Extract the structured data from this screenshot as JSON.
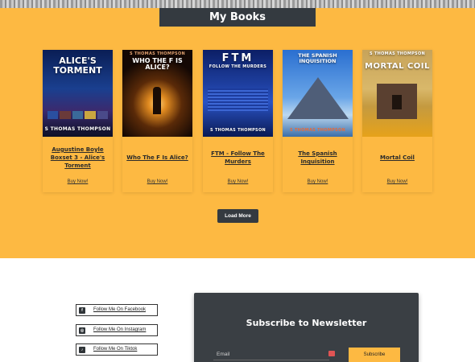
{
  "books_section": {
    "heading": "My Books",
    "background": "#fdb942",
    "load_more_label": "Load More"
  },
  "books": [
    {
      "title": "Augustine Boyle Boxset 3 - Alice's Torment",
      "cover_title": "ALICE'S TORMENT",
      "cover_author": "S THOMAS THOMPSON",
      "buy_label": "Buy Now!"
    },
    {
      "title": "Who The F Is Alice?",
      "cover_title": "WHO THE F IS ALICE?",
      "cover_author": "S THOMAS THOMPSON",
      "buy_label": "Buy Now!"
    },
    {
      "title": "FTM - Follow The Murders",
      "cover_title": "FTM",
      "cover_subtitle": "FOLLOW THE MURDERS",
      "cover_author": "S THOMAS THOMPSON",
      "buy_label": "Buy Now!"
    },
    {
      "title": "The Spanish Inquisition",
      "cover_title": "THE SPANISH INQUISITION",
      "cover_author": "S THOMAS THOMPSON",
      "buy_label": "Buy Now!"
    },
    {
      "title": "Mortal Coil",
      "cover_title": "MORTAL COIL",
      "cover_author": "S THOMAS THOMPSON",
      "buy_label": "Buy Now!"
    }
  ],
  "social_links": [
    {
      "label": "Follow Me On Facebook",
      "icon": "facebook-icon",
      "glyph": "f"
    },
    {
      "label": "Follow Me On Instagram",
      "icon": "instagram-icon",
      "glyph": "◎"
    },
    {
      "label": "Follow Me On Tiktok",
      "icon": "tiktok-icon",
      "glyph": "♪"
    }
  ],
  "newsletter": {
    "title": "Subscribe to Newsletter",
    "email_placeholder": "Email",
    "subscribe_label": "Subscribe"
  }
}
